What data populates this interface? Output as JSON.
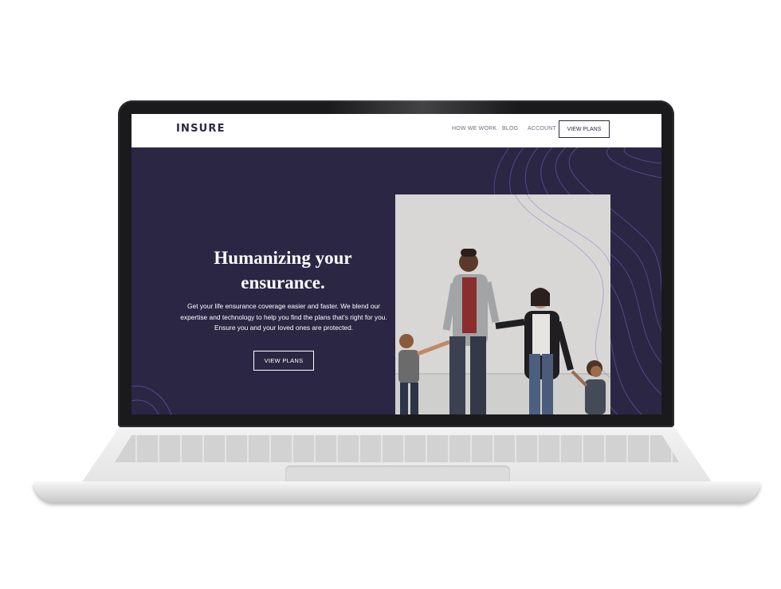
{
  "site": {
    "logo": "INSURE",
    "nav": {
      "items": [
        "HOW WE WORK",
        "BLOG",
        "ACCOUNT"
      ],
      "cta": "VIEW PLANS"
    },
    "hero": {
      "title_line1": "Humanizing your",
      "title_line2": "ensurance.",
      "text_line1": "Get your life ensurance coverage easier and faster. We blend our",
      "text_line2": "expertise and technology to help you find the plans that's right for you.",
      "text_line3": "Ensure you and your loved ones are protected.",
      "button": "VIEW PLANS"
    }
  },
  "colors": {
    "hero_background": "#2c2645",
    "nav_background": "#ffffff",
    "text_light": "#ffffff",
    "contour_lines": "#5b57a0"
  }
}
